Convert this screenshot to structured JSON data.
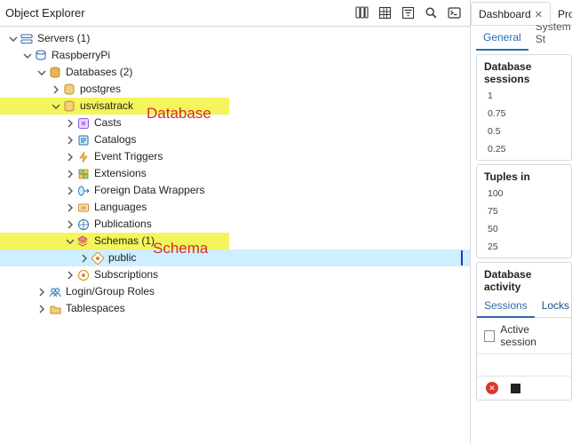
{
  "left": {
    "title": "Object Explorer",
    "toolbar_icons": [
      "database-vert-icon",
      "grid-icon",
      "filter-icon",
      "search-icon",
      "terminal-icon"
    ],
    "annotations": {
      "database": "Database",
      "schema": "Schema"
    },
    "tree": [
      {
        "depth": 0,
        "open": true,
        "icon": "servers",
        "label": "Servers (1)"
      },
      {
        "depth": 1,
        "open": true,
        "icon": "server-pg",
        "label": "RaspberryPi"
      },
      {
        "depth": 2,
        "open": true,
        "icon": "db-group",
        "label": "Databases (2)"
      },
      {
        "depth": 3,
        "open": false,
        "icon": "db",
        "label": "postgres"
      },
      {
        "depth": 3,
        "open": true,
        "icon": "db",
        "label": "usvisatrack",
        "highlight": "yellow"
      },
      {
        "depth": 4,
        "open": false,
        "icon": "casts",
        "label": "Casts"
      },
      {
        "depth": 4,
        "open": false,
        "icon": "catalog",
        "label": "Catalogs"
      },
      {
        "depth": 4,
        "open": false,
        "icon": "trigger",
        "label": "Event Triggers"
      },
      {
        "depth": 4,
        "open": false,
        "icon": "extension",
        "label": "Extensions"
      },
      {
        "depth": 4,
        "open": false,
        "icon": "fdw",
        "label": "Foreign Data Wrappers"
      },
      {
        "depth": 4,
        "open": false,
        "icon": "lang",
        "label": "Languages"
      },
      {
        "depth": 4,
        "open": false,
        "icon": "pub",
        "label": "Publications"
      },
      {
        "depth": 4,
        "open": true,
        "icon": "schemas",
        "label": "Schemas (1)",
        "highlight": "yellow"
      },
      {
        "depth": 5,
        "open": false,
        "icon": "schema",
        "label": "public",
        "highlight": "blue"
      },
      {
        "depth": 4,
        "open": false,
        "icon": "sub",
        "label": "Subscriptions"
      },
      {
        "depth": 2,
        "open": false,
        "icon": "roles",
        "label": "Login/Group Roles"
      },
      {
        "depth": 2,
        "open": false,
        "icon": "tablespace",
        "label": "Tablespaces"
      }
    ]
  },
  "right": {
    "top_tabs": [
      {
        "label": "Dashboard",
        "active": true,
        "closable": true
      },
      {
        "label": "Proper",
        "active": false,
        "closable": false
      }
    ],
    "sub_tabs": [
      {
        "label": "General",
        "active": true
      },
      {
        "label": "System St",
        "active": false
      }
    ],
    "activity": {
      "title": "Database activity",
      "tabs": [
        {
          "label": "Sessions",
          "active": true
        },
        {
          "label": "Locks",
          "active": false
        }
      ],
      "checkbox_label": "Active session"
    }
  },
  "chart_data": [
    {
      "type": "line",
      "title": "Database sessions",
      "ylabel": "",
      "ylim": [
        0,
        1
      ],
      "y_ticks": [
        "1",
        "0.75",
        "0.5",
        "0.25"
      ],
      "series": []
    },
    {
      "type": "line",
      "title": "Tuples in",
      "ylabel": "",
      "ylim": [
        0,
        100
      ],
      "y_ticks": [
        "100",
        "75",
        "50",
        "25"
      ],
      "series": []
    }
  ]
}
